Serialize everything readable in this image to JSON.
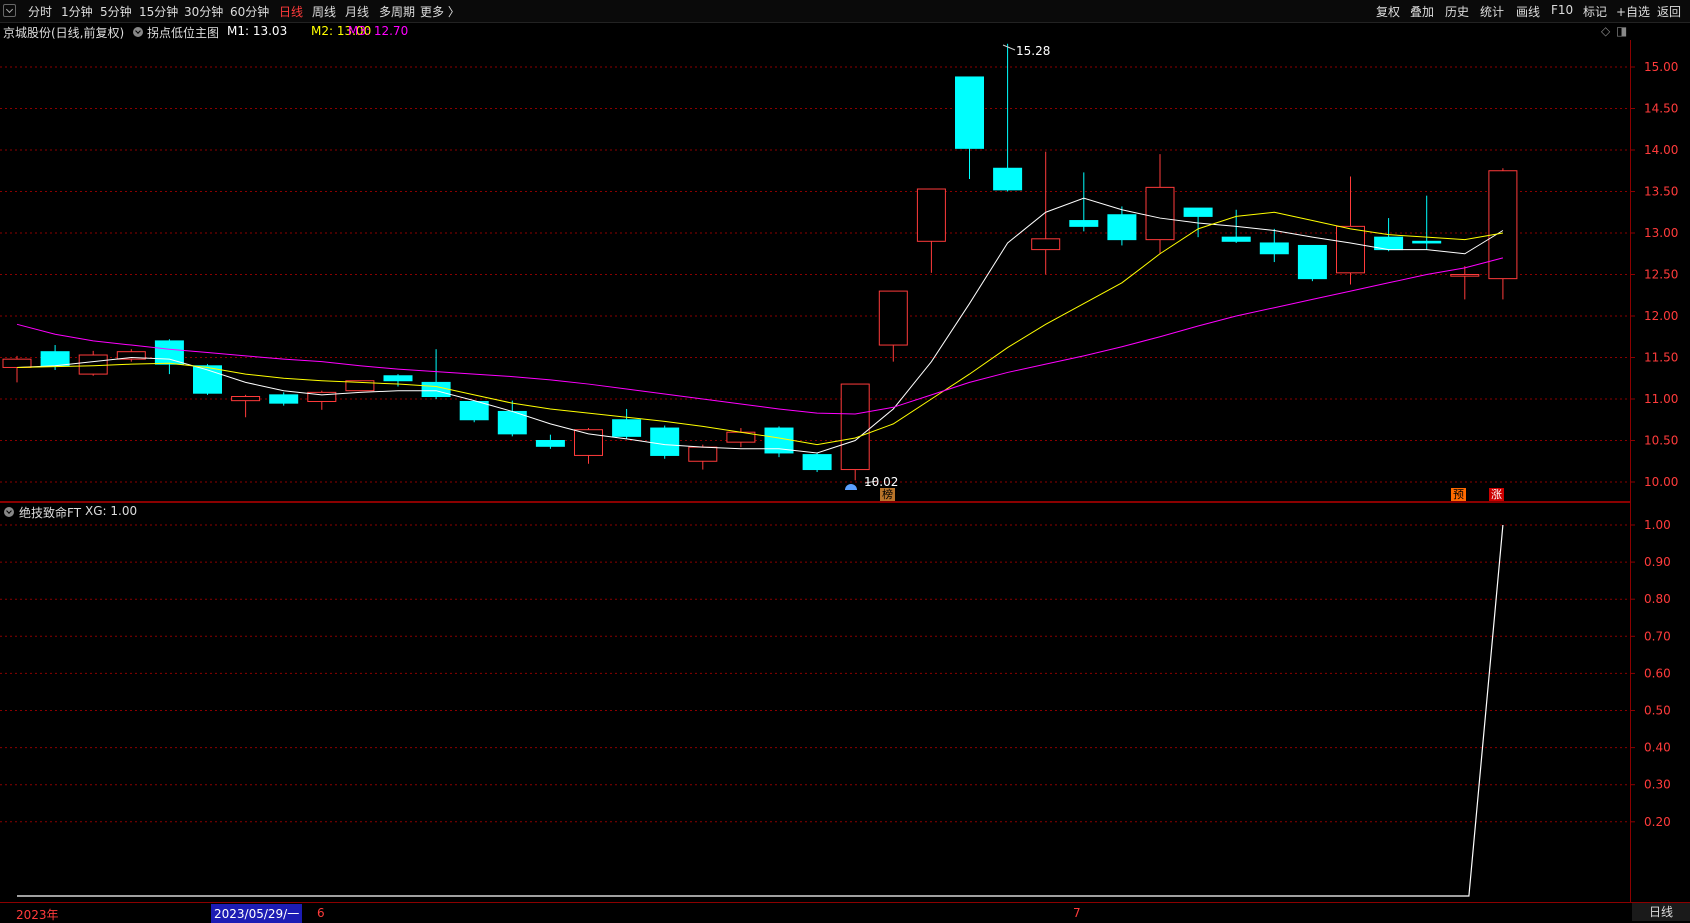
{
  "toolbar": {
    "periods": [
      "分时",
      "1分钟",
      "5分钟",
      "15分钟",
      "30分钟",
      "60分钟",
      "日线",
      "周线",
      "月线",
      "多周期",
      "更多 〉"
    ],
    "active": "日线",
    "right": [
      "复权",
      "叠加",
      "历史",
      "统计",
      "画线",
      "F10",
      "标记",
      "+自选",
      "返回"
    ]
  },
  "main": {
    "stock_name": "京城股份(日线,前复权)",
    "indicator": "拐点低位主图",
    "m1": "M1: 13.03",
    "m2": "M2: 13.00",
    "m3": "M3: 12.70",
    "ctrl_diamond": "◇",
    "ctrl_box": "◨",
    "high_label": "15.28",
    "low_label": "10.02",
    "mark_bang": "榜",
    "mark_yu": "预",
    "mark_zhang": "涨"
  },
  "sub": {
    "indicator": "绝技致命FT",
    "xg": "XG: 1.00"
  },
  "axis": {
    "price_ticks": [
      "15.00",
      "14.50",
      "14.00",
      "13.50",
      "13.00",
      "12.50",
      "12.00",
      "11.50",
      "11.00",
      "10.50",
      "10.00"
    ],
    "sub_ticks": [
      "1.00",
      "0.90",
      "0.80",
      "0.70",
      "0.60",
      "0.50",
      "0.40",
      "0.30",
      "0.20"
    ]
  },
  "datebar": {
    "year": "2023年",
    "cursor": "2023/05/29/一",
    "mark6": "6",
    "mark7": "7",
    "period": "日线"
  },
  "colors": {
    "up": "#ff3b3b",
    "down": "#00ffff",
    "m1": "#ffffff",
    "m2": "#ffff00",
    "m3": "#ff00ff",
    "grid": "#8b0000",
    "axis_text": "#ff3b3b"
  },
  "chart_data": {
    "type": "candlestick",
    "candles": [
      {
        "o": 11.38,
        "c": 11.48,
        "h": 11.52,
        "l": 11.2
      },
      {
        "o": 11.57,
        "c": 11.4,
        "h": 11.65,
        "l": 11.35
      },
      {
        "o": 11.3,
        "c": 11.53,
        "h": 11.58,
        "l": 11.28
      },
      {
        "o": 11.48,
        "c": 11.57,
        "h": 11.6,
        "l": 11.45
      },
      {
        "o": 11.7,
        "c": 11.42,
        "h": 11.72,
        "l": 11.3
      },
      {
        "o": 11.4,
        "c": 11.07,
        "h": 11.42,
        "l": 11.05
      },
      {
        "o": 10.98,
        "c": 11.03,
        "h": 11.05,
        "l": 10.78
      },
      {
        "o": 11.05,
        "c": 10.95,
        "h": 11.08,
        "l": 10.92
      },
      {
        "o": 10.97,
        "c": 11.08,
        "h": 11.1,
        "l": 10.87
      },
      {
        "o": 11.1,
        "c": 11.22,
        "h": 11.22,
        "l": 11.1
      },
      {
        "o": 11.28,
        "c": 11.22,
        "h": 11.3,
        "l": 11.15
      },
      {
        "o": 11.2,
        "c": 11.03,
        "h": 11.6,
        "l": 11.0
      },
      {
        "o": 10.97,
        "c": 10.75,
        "h": 10.97,
        "l": 10.72
      },
      {
        "o": 10.85,
        "c": 10.58,
        "h": 10.98,
        "l": 10.55
      },
      {
        "o": 10.5,
        "c": 10.43,
        "h": 10.57,
        "l": 10.4
      },
      {
        "o": 10.32,
        "c": 10.63,
        "h": 10.65,
        "l": 10.22
      },
      {
        "o": 10.75,
        "c": 10.55,
        "h": 10.88,
        "l": 10.52
      },
      {
        "o": 10.65,
        "c": 10.32,
        "h": 10.68,
        "l": 10.28
      },
      {
        "o": 10.25,
        "c": 10.42,
        "h": 10.45,
        "l": 10.15
      },
      {
        "o": 10.48,
        "c": 10.6,
        "h": 10.65,
        "l": 10.42
      },
      {
        "o": 10.65,
        "c": 10.35,
        "h": 10.67,
        "l": 10.3
      },
      {
        "o": 10.33,
        "c": 10.15,
        "h": 10.35,
        "l": 10.12
      },
      {
        "o": 10.15,
        "c": 11.18,
        "h": 11.18,
        "l": 10.02
      },
      {
        "o": 11.65,
        "c": 12.3,
        "h": 12.3,
        "l": 11.45
      },
      {
        "o": 12.9,
        "c": 13.53,
        "h": 13.53,
        "l": 12.52
      },
      {
        "o": 14.88,
        "c": 14.02,
        "h": 14.88,
        "l": 13.65
      },
      {
        "o": 13.78,
        "c": 13.52,
        "h": 15.28,
        "l": 13.5
      },
      {
        "o": 12.8,
        "c": 12.93,
        "h": 13.98,
        "l": 12.5
      },
      {
        "o": 13.15,
        "c": 13.08,
        "h": 13.73,
        "l": 13.02
      },
      {
        "o": 13.22,
        "c": 12.92,
        "h": 13.32,
        "l": 12.85
      },
      {
        "o": 12.92,
        "c": 13.55,
        "h": 13.95,
        "l": 12.75
      },
      {
        "o": 13.3,
        "c": 13.2,
        "h": 13.3,
        "l": 12.95
      },
      {
        "o": 12.95,
        "c": 12.9,
        "h": 13.28,
        "l": 12.88
      },
      {
        "o": 12.88,
        "c": 12.75,
        "h": 13.05,
        "l": 12.65
      },
      {
        "o": 12.85,
        "c": 12.45,
        "h": 12.85,
        "l": 12.42
      },
      {
        "o": 12.52,
        "c": 13.08,
        "h": 13.68,
        "l": 12.38
      },
      {
        "o": 12.95,
        "c": 12.8,
        "h": 13.18,
        "l": 12.78
      },
      {
        "o": 12.9,
        "c": 12.88,
        "h": 13.45,
        "l": 12.8
      },
      {
        "o": 12.48,
        "c": 12.5,
        "h": 12.6,
        "l": 12.2
      },
      {
        "o": 12.45,
        "c": 13.75,
        "h": 13.78,
        "l": 12.2
      }
    ],
    "series": [
      {
        "name": "M1",
        "values": [
          11.38,
          11.4,
          11.45,
          11.5,
          11.48,
          11.35,
          11.2,
          11.1,
          11.05,
          11.08,
          11.1,
          11.1,
          10.98,
          10.85,
          10.7,
          10.58,
          10.52,
          10.45,
          10.42,
          10.4,
          10.4,
          10.35,
          10.5,
          10.88,
          11.45,
          12.15,
          12.88,
          13.25,
          13.42,
          13.28,
          13.18,
          13.12,
          13.08,
          13.03,
          12.95,
          12.88,
          12.8,
          12.8,
          12.75,
          13.03
        ]
      },
      {
        "name": "M2",
        "values": [
          11.38,
          11.39,
          11.4,
          11.42,
          11.43,
          11.38,
          11.3,
          11.25,
          11.22,
          11.2,
          11.18,
          11.15,
          11.05,
          10.95,
          10.88,
          10.83,
          10.78,
          10.73,
          10.67,
          10.6,
          10.53,
          10.45,
          10.53,
          10.7,
          11.0,
          11.3,
          11.62,
          11.9,
          12.15,
          12.4,
          12.75,
          13.05,
          13.2,
          13.25,
          13.15,
          13.05,
          12.98,
          12.95,
          12.92,
          13.0
        ]
      },
      {
        "name": "M3",
        "values": [
          11.9,
          11.78,
          11.7,
          11.65,
          11.6,
          11.56,
          11.52,
          11.48,
          11.45,
          11.4,
          11.36,
          11.33,
          11.3,
          11.27,
          11.23,
          11.18,
          11.12,
          11.06,
          11.0,
          10.94,
          10.88,
          10.83,
          10.82,
          10.9,
          11.05,
          11.2,
          11.32,
          11.42,
          11.52,
          11.63,
          11.75,
          11.88,
          12.0,
          12.1,
          12.2,
          12.3,
          12.4,
          12.5,
          12.58,
          12.7
        ]
      }
    ],
    "sub_series": {
      "name": "XG",
      "values": [
        0,
        0,
        0,
        0,
        0,
        0,
        0,
        0,
        0,
        0,
        0,
        0,
        0,
        0,
        0,
        0,
        0,
        0,
        0,
        0,
        0,
        0,
        0,
        0,
        0,
        0,
        0,
        0,
        0,
        0,
        0,
        0,
        0,
        0,
        0,
        0,
        0,
        0,
        0,
        1
      ]
    },
    "price_range": [
      9.87,
      15.37
    ],
    "sub_range": [
      0,
      1
    ]
  }
}
